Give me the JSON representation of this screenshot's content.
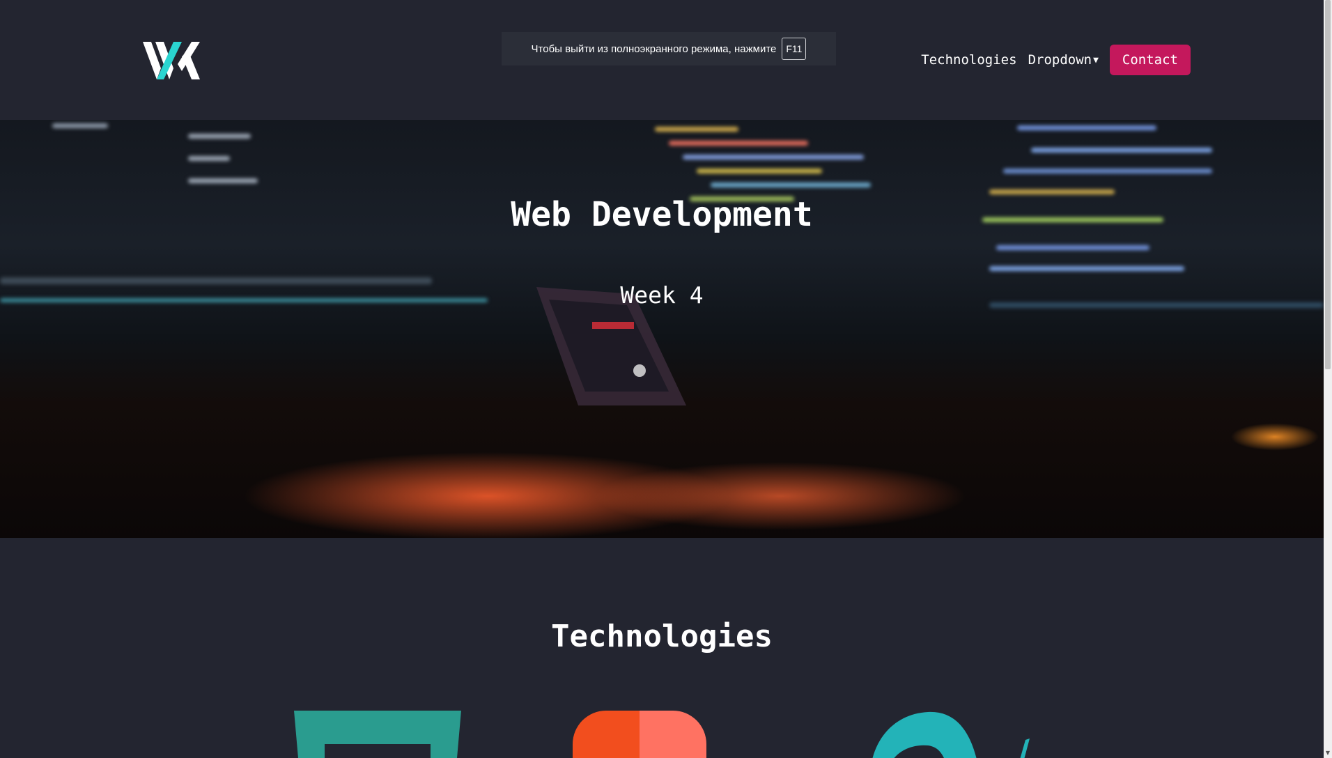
{
  "navbar": {
    "logo_icon": "wx-logo",
    "links": [
      {
        "label": "Technologies"
      },
      {
        "label": "Dropdown"
      }
    ],
    "dropdown_icon": "caret-down-icon",
    "contact_label": "Contact",
    "accent_color": "#c4185c"
  },
  "fullscreen_notice": {
    "text": "Чтобы выйти из полноэкранного режима, нажмите",
    "key": "F11"
  },
  "hero": {
    "title": "Web Development",
    "subtitle": "Week 4"
  },
  "technologies": {
    "heading": "Technologies",
    "icons": [
      "html5-icon",
      "figma-icon",
      "sass-icon"
    ]
  },
  "colors": {
    "background": "#232530",
    "accent": "#c4185c",
    "logo_teal": "#2ad4d0"
  }
}
